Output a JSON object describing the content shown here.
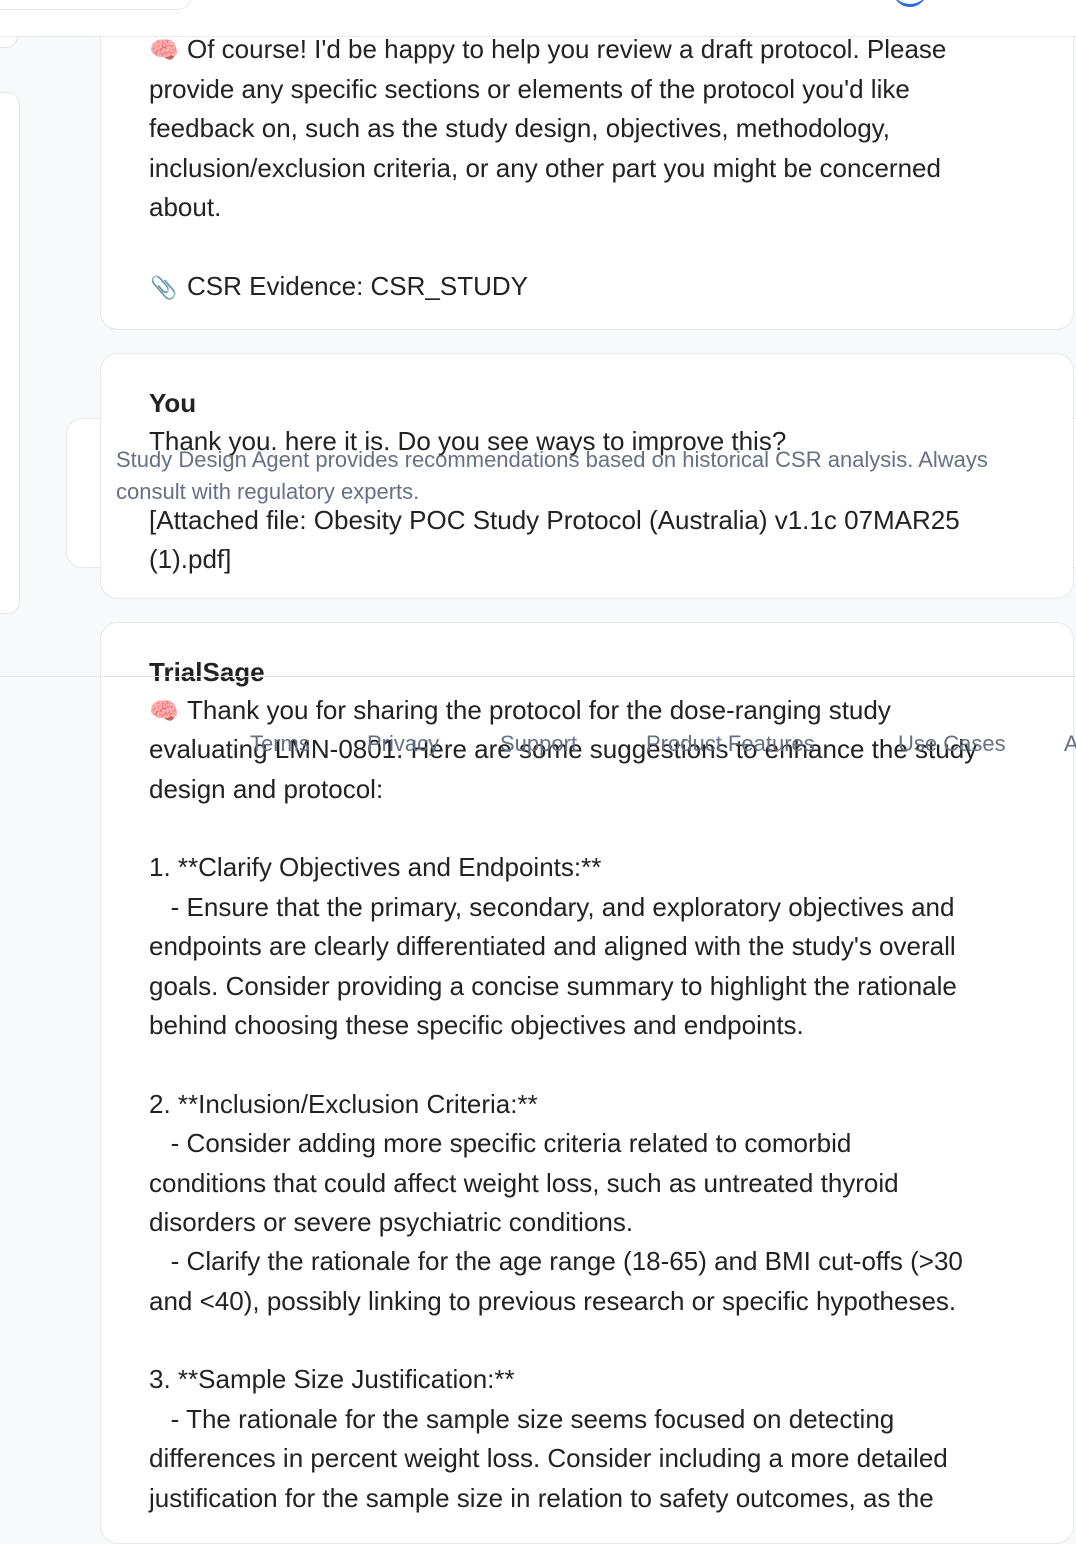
{
  "messages": [
    {
      "lines": [
        "Of course! I'd be happy to help you review a draft protocol. Please",
        "provide any specific sections or elements of the protocol you'd like",
        "feedback on, such as the study design, objectives, methodology,",
        "inclusion/exclusion criteria, or any other part you might be concerned",
        "about."
      ],
      "evidence": "CSR Evidence: CSR_STUDY"
    },
    {
      "sender": "You",
      "lines": [
        "Thank you. here it is. Do you see ways to improve this?",
        "",
        "[Attached file: Obesity POC Study Protocol (Australia) v1.1c 07MAR25",
        "(1).pdf]"
      ]
    },
    {
      "sender": "TrialSage",
      "lines": [
        "Thank you for sharing the protocol for the dose-ranging study",
        "evaluating LMN-0801. Here are some suggestions to enhance the study",
        "design and protocol:",
        "",
        "1. **Clarify Objectives and Endpoints:**",
        "   - Ensure that the primary, secondary, and exploratory objectives and",
        "endpoints are clearly differentiated and aligned with the study's overall",
        "goals. Consider providing a concise summary to highlight the rationale",
        "behind choosing these specific objectives and endpoints.",
        "",
        "2. **Inclusion/Exclusion Criteria:**",
        "   - Consider adding more specific criteria related to comorbid",
        "conditions that could affect weight loss, such as untreated thyroid",
        "disorders or severe psychiatric conditions.",
        "   - Clarify the rationale for the age range (18-65) and BMI cut-offs (>30",
        "and <40), possibly linking to previous research or specific hypotheses.",
        "",
        "3. **Sample Size Justification:**",
        "   - The rationale for the sample size seems focused on detecting",
        "differences in percent weight loss. Consider including a more detailed",
        "justification for the sample size in relation to safety outcomes, as the"
      ]
    }
  ],
  "disclaimer_lines": [
    "Study Design Agent provides recommendations based on historical CSR analysis. Always",
    "consult with regulatory experts."
  ],
  "footer": {
    "terms": "Terms",
    "privacy": "Privacy",
    "support": "Support",
    "features": "Product Features",
    "use_cases": "Use Cases",
    "cut": "A"
  },
  "icons": {
    "assistant": "brain-icon",
    "evidence": "paperclip-icon"
  },
  "colors": {
    "accent": "#2d6bd8",
    "muted": "#667085",
    "border": "#e6e8ec"
  }
}
